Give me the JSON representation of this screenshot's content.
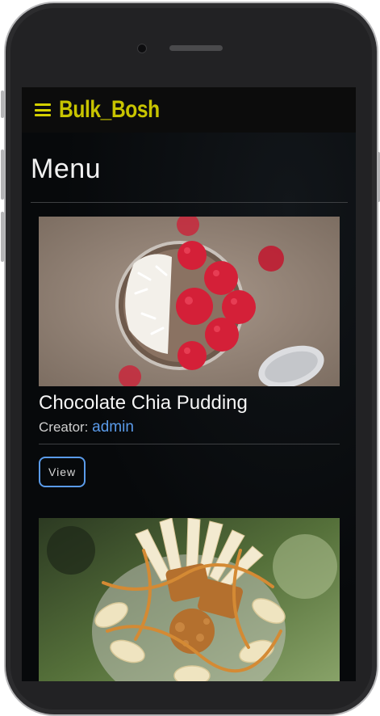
{
  "navbar": {
    "brand": "Bulk_Bosh",
    "brand_color": "#c8c400",
    "menu_icon": "hamburger-menu-icon"
  },
  "page": {
    "title": "Menu"
  },
  "recipes": [
    {
      "title": "Chocolate Chia Pudding",
      "creator_label": "Creator:",
      "creator_name": "admin",
      "view_label": "View",
      "image_desc": "chia-pudding-with-raspberries-and-coconut"
    },
    {
      "image_desc": "banana-biscoff-dessert-jar"
    }
  ],
  "colors": {
    "accent_link": "#5a9bea",
    "background": "#07090b"
  }
}
